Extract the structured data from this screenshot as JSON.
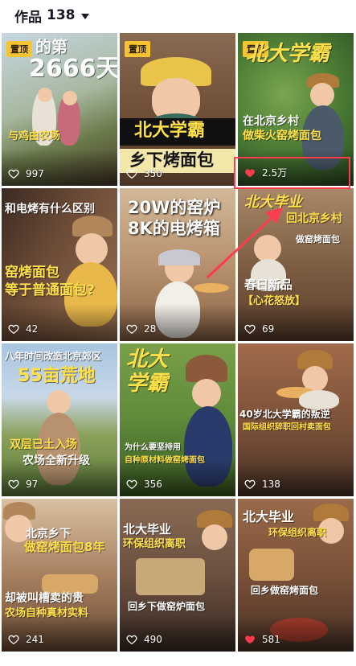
{
  "header": {
    "title": "作品",
    "count": "138"
  },
  "tiles": [
    {
      "pinned": "置顶",
      "likes": "997",
      "liked": false,
      "bg": "#8a9a6a",
      "cap1": "的第",
      "cap2": "2666天",
      "cap3": "与鸡由农场"
    },
    {
      "pinned": "置顶",
      "likes": "350",
      "liked": false,
      "bg": "#7a5a40",
      "cap1": "北大学霸",
      "cap2": "乡下烤面包"
    },
    {
      "pinned": "置顶",
      "likes": "2.5万",
      "liked": true,
      "bg": "#4f7a3c",
      "cap1": "北大学霸",
      "cap2": "在北京乡村",
      "cap3": "做柴火窑烤面包"
    },
    {
      "likes": "42",
      "liked": false,
      "bg": "#6b4a36",
      "cap1": "和电烤有什么区别",
      "cap2": "窑烤面包",
      "cap3": "等于普通面包?"
    },
    {
      "likes": "28",
      "liked": false,
      "bg": "#a07856",
      "cap1": "20W的窑炉",
      "cap2": "8K的电烤箱"
    },
    {
      "likes": "69",
      "liked": false,
      "bg": "#8c6a4a",
      "cap1": "北大毕业",
      "cap2": "回北京乡村",
      "cap3": "做窑烤面包",
      "cap4": "春日新品",
      "cap5": "【心花怒放】"
    },
    {
      "likes": "97",
      "liked": false,
      "bg": "#8aa6c6",
      "cap1": "八年时间改造北京郊区",
      "cap2": "55亩荒地",
      "cap3": "双层已土入场",
      "cap4": "农场全新升级"
    },
    {
      "likes": "356",
      "liked": false,
      "bg": "#5e8a3a",
      "cap1": "北大",
      "cap2": "学霸",
      "cap3": "为什么要坚持用",
      "cap4": "自种原材料做窑烤面包"
    },
    {
      "likes": "138",
      "liked": false,
      "bg": "#7a5038",
      "cap1": "40岁北大学霸的叛逆",
      "cap2": "国际组织辞职回村卖面包"
    },
    {
      "likes": "241",
      "liked": false,
      "bg": "#9a7a5a",
      "cap1": "北京乡下",
      "cap2": "做窑烤面包8年",
      "cap3": "却被叫槽卖的贵",
      "cap4": "农场自种真材实料"
    },
    {
      "likes": "490",
      "liked": false,
      "bg": "#6a5040",
      "cap1": "北大毕业",
      "cap2": "环保组织离职",
      "cap3": "回乡下做窑炉面包"
    },
    {
      "likes": "581",
      "liked": true,
      "bg": "#8a5a40",
      "cap1": "北大毕业",
      "cap2": "环保组织离职",
      "cap3": "回乡做窑烤面包"
    }
  ],
  "colors": {
    "accent_red": "#ff3b4e",
    "pin_yellow": "#f6c432",
    "caption_yellow": "#ffe04a"
  }
}
